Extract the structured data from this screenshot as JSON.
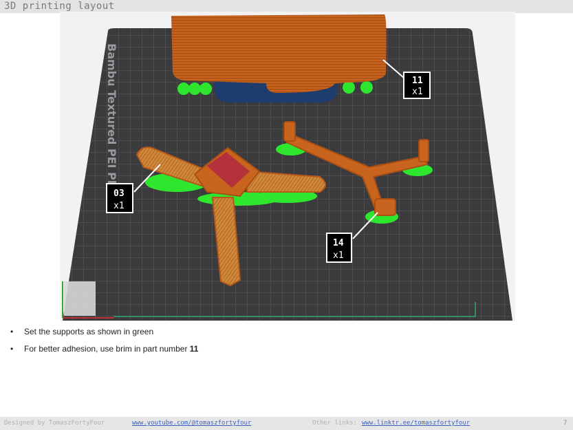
{
  "header": {
    "title": "3D printing layout"
  },
  "viewport": {
    "plate_name": "Bambu Textured PEI Plate",
    "labels": [
      {
        "part": "11",
        "qty": "x1"
      },
      {
        "part": "03",
        "qty": "x1"
      },
      {
        "part": "14",
        "qty": "x1"
      }
    ]
  },
  "instructions": {
    "bullet": "•",
    "line1": "Set the supports as shown in green",
    "line2_text": "For better adhesion, use brim in part number ",
    "line2_part": "11"
  },
  "footer": {
    "designed_by": "Designed by TomaszFortyFour",
    "youtube_link": "www.youtube.com/@tomaszfortyfour",
    "other_links_label": "Other links:",
    "linktree_link": "www.linktr.ee/tomaszfortyfour",
    "page_number": "7"
  },
  "colors": {
    "plate": "#3b3b3d",
    "grid": "#6e6e72",
    "part": "#c8641e",
    "support": "#2ee62e",
    "shadow": "#1e3c6e",
    "label_bg": "#000000",
    "label_fg": "#ffffff"
  }
}
